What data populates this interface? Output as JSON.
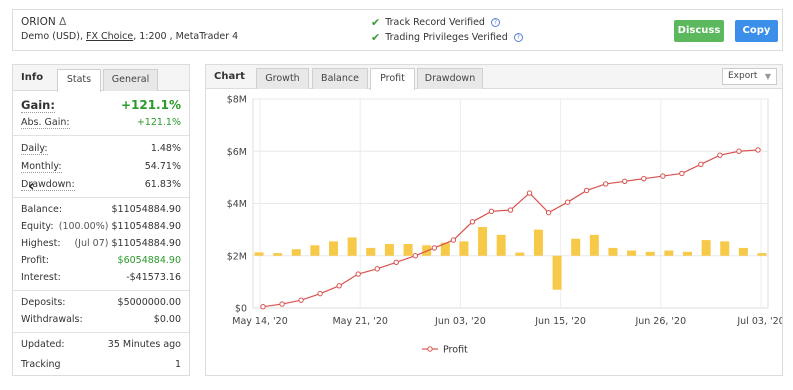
{
  "account": {
    "name": "ORION",
    "delta_symbol": "Δ",
    "type": "Demo (USD),",
    "broker": "FX Choice",
    "details": ", 1:200 , MetaTrader 4"
  },
  "verification": {
    "track_record": "Track Record Verified",
    "trading_privileges": "Trading Privileges Verified",
    "check_icon": "✔",
    "help_icon": "?"
  },
  "actions": {
    "discuss_label": "Discuss",
    "copy_label": "Copy"
  },
  "left_tabs": {
    "title": "Info",
    "stats": "Stats",
    "general": "General"
  },
  "stats": {
    "gain": {
      "label": "Gain:",
      "value": "+121.1%"
    },
    "abs_gain": {
      "label": "Abs. Gain:",
      "value": "+121.1%"
    },
    "daily": {
      "label": "Daily:",
      "value": "1.48%"
    },
    "monthly": {
      "label": "Monthly:",
      "value": "54.71%"
    },
    "drawdown": {
      "label": "Drawdown:",
      "value": "61.83%"
    },
    "balance": {
      "label": "Balance:",
      "value": "$11054884.90"
    },
    "equity": {
      "label": "Equity:",
      "note": "(100.00%)",
      "value": "$11054884.90"
    },
    "highest": {
      "label": "Highest:",
      "note": "(Jul 07)",
      "value": "$11054884.90"
    },
    "profit": {
      "label": "Profit:",
      "value": "$6054884.90"
    },
    "interest": {
      "label": "Interest:",
      "value": "-$41573.16"
    },
    "deposits": {
      "label": "Deposits:",
      "value": "$5000000.00"
    },
    "withdrawals": {
      "label": "Withdrawals:",
      "value": "$0.00"
    },
    "updated": {
      "label": "Updated:",
      "value": "35 Minutes ago"
    },
    "tracking": {
      "label": "Tracking",
      "value": "1"
    }
  },
  "chart_tabs": {
    "title": "Chart",
    "items": [
      "Growth",
      "Balance",
      "Profit",
      "Drawdown"
    ],
    "active": "Profit",
    "export_label": "Export",
    "export_arrow": "▼"
  },
  "nav": {
    "prev": "‹",
    "next": "›"
  },
  "colors": {
    "line": "#d9534f",
    "bar": "#f7c948",
    "green": "#2a9a2a",
    "discuss": "#5cb85c",
    "copy": "#3b8fe8"
  },
  "chart_data": {
    "type": "line",
    "legend": "Profit",
    "legend_position": "bottom-center",
    "y_ticks": [
      "$0",
      "$2M",
      "$4M",
      "$6M",
      "$8M"
    ],
    "x_ticks": [
      "May 14, '20",
      "May 21, '20",
      "Jun 03, '20",
      "Jun 15, '20",
      "Jun 26, '20",
      "Jul 03, '20"
    ],
    "ylim": [
      0,
      8000000
    ],
    "grid": true,
    "profit_line": [
      50000,
      150000,
      300000,
      550000,
      850000,
      1300000,
      1500000,
      1750000,
      2000000,
      2300000,
      2600000,
      3300000,
      3700000,
      3750000,
      4400000,
      3650000,
      4050000,
      4500000,
      4750000,
      4850000,
      4950000,
      5050000,
      5150000,
      5500000,
      5850000,
      6000000,
      6050000
    ],
    "daily_bars": [
      130000,
      100000,
      250000,
      400000,
      550000,
      700000,
      300000,
      450000,
      450000,
      400000,
      500000,
      550000,
      1100000,
      800000,
      120000,
      1000000,
      -1300000,
      650000,
      800000,
      300000,
      200000,
      150000,
      200000,
      150000,
      600000,
      550000,
      300000,
      100000
    ]
  }
}
